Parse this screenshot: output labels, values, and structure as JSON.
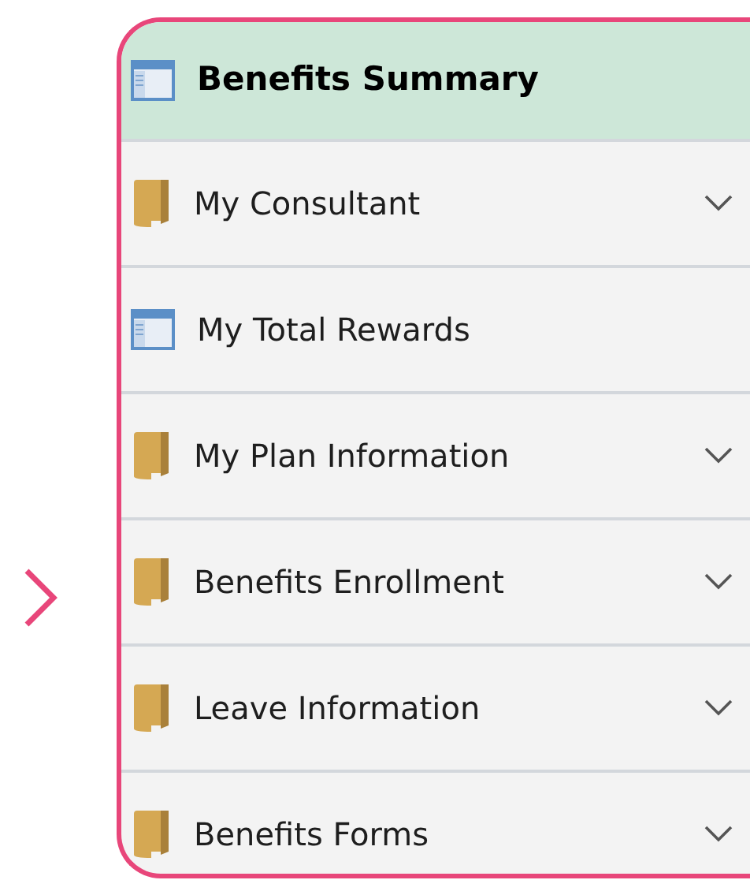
{
  "menu": {
    "items": [
      {
        "label": "Benefits Summary",
        "kind": "page",
        "selected": true,
        "expandable": false,
        "pointer": false
      },
      {
        "label": "My Consultant",
        "kind": "folder",
        "selected": false,
        "expandable": true,
        "pointer": false
      },
      {
        "label": "My Total Rewards",
        "kind": "page",
        "selected": false,
        "expandable": false,
        "pointer": false
      },
      {
        "label": "My Plan Information",
        "kind": "folder",
        "selected": false,
        "expandable": true,
        "pointer": false
      },
      {
        "label": "Benefits Enrollment",
        "kind": "folder",
        "selected": false,
        "expandable": true,
        "pointer": true
      },
      {
        "label": "Leave Information",
        "kind": "folder",
        "selected": false,
        "expandable": true,
        "pointer": false
      },
      {
        "label": "Benefits Forms",
        "kind": "folder",
        "selected": false,
        "expandable": true,
        "pointer": false
      }
    ]
  }
}
